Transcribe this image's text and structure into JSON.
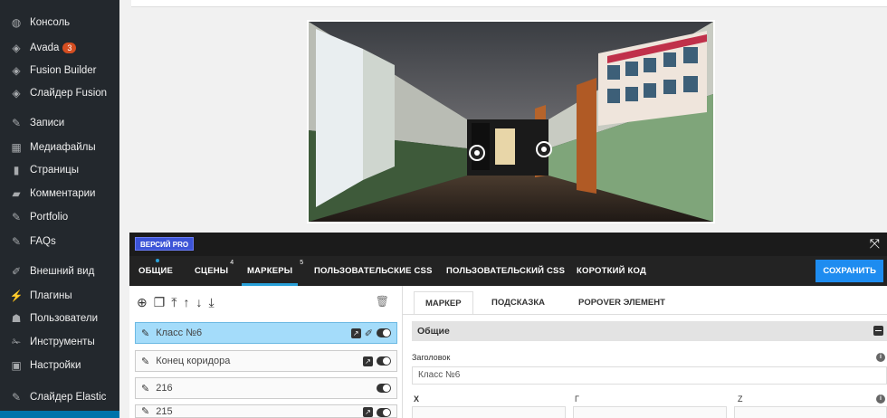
{
  "sidebar": {
    "items": [
      {
        "label": "Консоль",
        "icon": "dashboard-icon",
        "glyph": "◍"
      },
      {
        "label": "Avada",
        "icon": "avada-icon",
        "glyph": "◈",
        "badge": "3"
      },
      {
        "label": "Fusion Builder",
        "icon": "fusion-builder-icon",
        "glyph": "◈"
      },
      {
        "label": "Слайдер Fusion",
        "icon": "fusion-slider-icon",
        "glyph": "◈"
      },
      {
        "label": "Записи",
        "icon": "posts-pin-icon",
        "glyph": "✎"
      },
      {
        "label": "Медиафайлы",
        "icon": "media-icon",
        "glyph": "▦"
      },
      {
        "label": "Страницы",
        "icon": "pages-icon",
        "glyph": "▮"
      },
      {
        "label": "Комментарии",
        "icon": "comments-icon",
        "glyph": "▰"
      },
      {
        "label": "Portfolio",
        "icon": "portfolio-pin-icon",
        "glyph": "✎"
      },
      {
        "label": "FAQs",
        "icon": "faqs-pin-icon",
        "glyph": "✎"
      },
      {
        "label": "Внешний вид",
        "icon": "appearance-icon",
        "glyph": "✐"
      },
      {
        "label": "Плагины",
        "icon": "plugins-icon",
        "glyph": "⚡"
      },
      {
        "label": "Пользователи",
        "icon": "users-icon",
        "glyph": "☗"
      },
      {
        "label": "Инструменты",
        "icon": "tools-icon",
        "glyph": "✁"
      },
      {
        "label": "Настройки",
        "icon": "settings-icon",
        "glyph": "▣"
      },
      {
        "label": "Слайдер Elastic",
        "icon": "elastic-slider-icon",
        "glyph": "✎"
      }
    ]
  },
  "editor": {
    "pro_badge": "ВЕРСИЙ PRO",
    "tabs": [
      {
        "label": "ОБЩИЕ",
        "count": ""
      },
      {
        "label": "СЦЕНЫ",
        "count": "4"
      },
      {
        "label": "МАРКЕРЫ",
        "count": "5"
      },
      {
        "label": "ПОЛЬЗОВАТЕЛЬСКИЕ CSS",
        "count": ""
      },
      {
        "label": "ПОЛЬЗОВАТЕЛЬСКИЙ CSS",
        "count": ""
      },
      {
        "label": "КОРОТКИЙ КОД",
        "count": ""
      }
    ],
    "save_label": "СОХРАНИТЬ",
    "markers": [
      {
        "label": "Класс №6",
        "selected": true
      },
      {
        "label": "Конец коридора",
        "selected": false
      },
      {
        "label": "216",
        "selected": false
      },
      {
        "label": "215",
        "selected": false
      }
    ],
    "prop_tabs": [
      "МАРКЕР",
      "ПОДСКАЗКА",
      "POPOVER ЭЛЕМЕНТ"
    ],
    "section_title": "Общие",
    "title_label": "Заголовок",
    "title_value": "Класс №6",
    "coord_labels": {
      "x": "X",
      "y": "Г",
      "z": "Z"
    }
  },
  "colors": {
    "sidebar_bg": "#23282d",
    "accent_blue": "#1e8cf0",
    "selected_row": "#a4dcfa",
    "badge_orange": "#d54e21"
  }
}
